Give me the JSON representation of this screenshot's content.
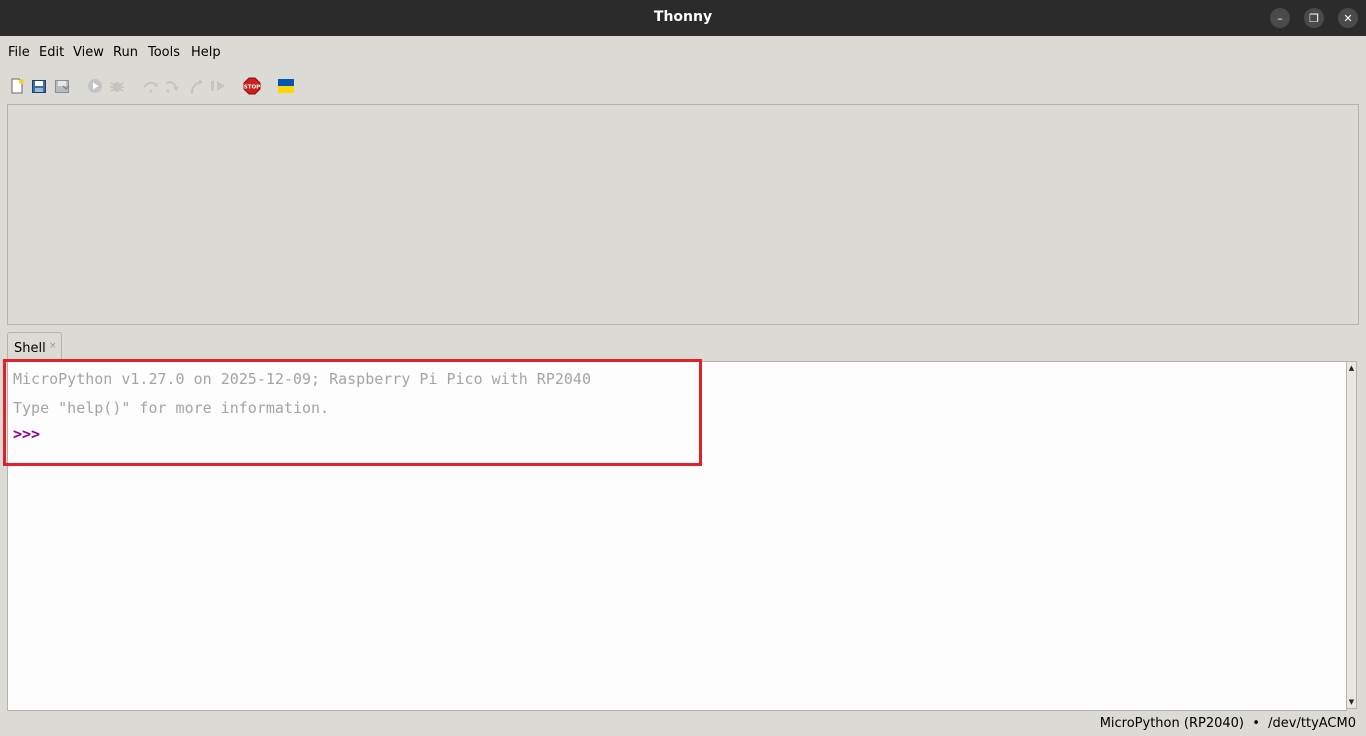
{
  "window": {
    "title": "Thonny",
    "controls": [
      "minimize-icon",
      "restore-icon",
      "close-icon"
    ]
  },
  "menu": {
    "items": [
      "File",
      "Edit",
      "View",
      "Run",
      "Tools",
      "Help"
    ]
  },
  "toolbar": {
    "icons": [
      "new-file-icon",
      "open-file-icon",
      "save-file-icon",
      "run-icon",
      "debug-icon",
      "step-over-icon",
      "step-into-icon",
      "step-out-icon",
      "resume-icon",
      "stop-icon",
      "ukraine-flag-icon"
    ],
    "stop_label": "STOP"
  },
  "shell": {
    "tab_label": "Shell",
    "tab_close": "×",
    "banner": "MicroPython v1.27.0 on 2025-12-09; Raspberry Pi Pico with RP2040",
    "help_line": "Type \"help()\" for more information.",
    "prompt": ">>>"
  },
  "status": {
    "text": "MicroPython (RP2040)  •  /dev/ttyACM0"
  },
  "colors": {
    "titlebar": "#2b2b2b",
    "window_bg": "#dcdad5",
    "prompt": "#8b008b",
    "shell_text": "#a4a4a4",
    "highlight_border": "#e0202a",
    "stop_red": "#cc1f1f"
  }
}
